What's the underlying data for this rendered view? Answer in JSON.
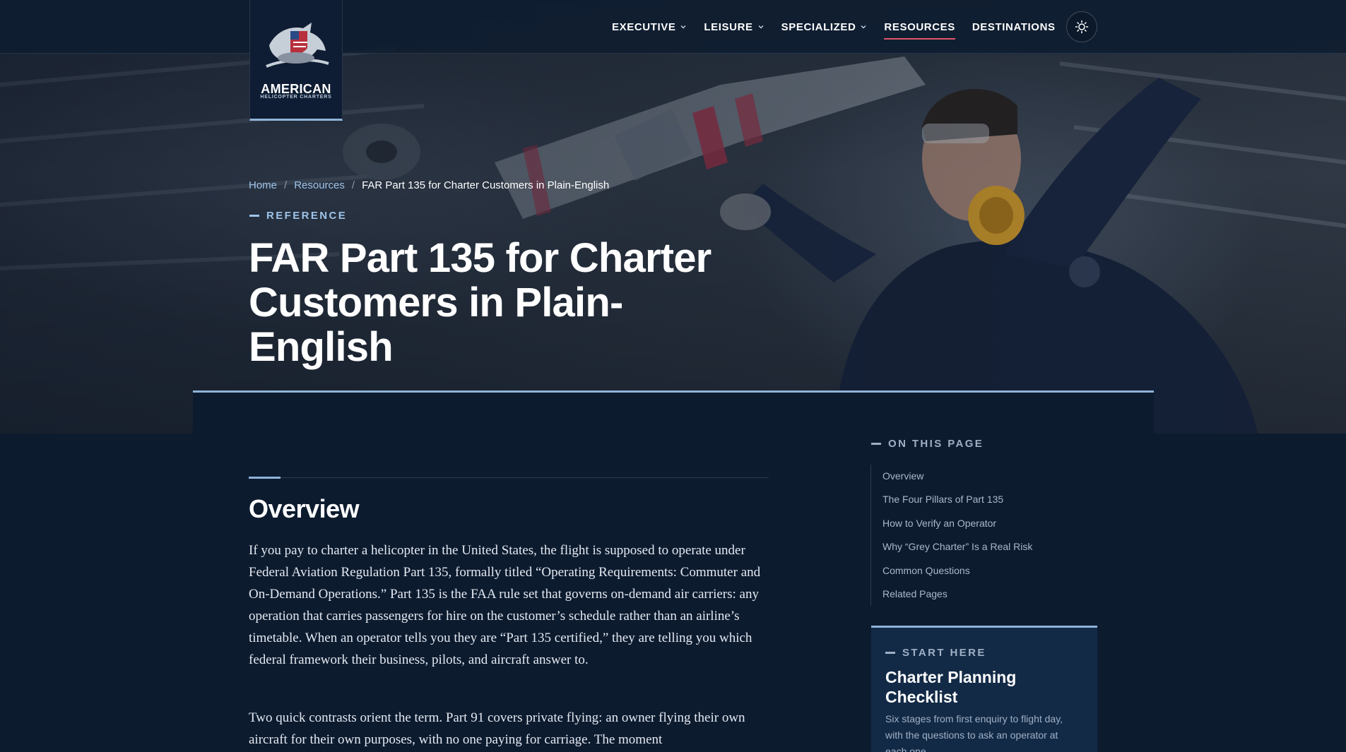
{
  "brand": {
    "name": "AMERICAN",
    "tagline": "HELICOPTER CHARTERS"
  },
  "nav": {
    "items": [
      {
        "label": "EXECUTIVE",
        "has_dropdown": true
      },
      {
        "label": "LEISURE",
        "has_dropdown": true
      },
      {
        "label": "SPECIALIZED",
        "has_dropdown": true
      },
      {
        "label": "RESOURCES",
        "has_dropdown": false,
        "active": true
      },
      {
        "label": "DESTINATIONS",
        "has_dropdown": false
      }
    ],
    "theme_toggle_icon": "sun-icon"
  },
  "breadcrumb": {
    "home": "Home",
    "resources": "Resources",
    "current": "FAR Part 135 for Charter Customers in Plain-English"
  },
  "hero": {
    "eyebrow": "REFERENCE",
    "title": "FAR Part 135 for Charter Customers in Plain-English"
  },
  "article": {
    "section_title": "Overview",
    "paragraph1": "If you pay to charter a helicopter in the United States, the flight is supposed to operate under Federal Aviation Regulation Part 135, formally titled “Operating Requirements: Commuter and On-Demand Operations.” Part 135 is the FAA rule set that governs on-demand air carriers: any operation that carries passengers for hire on the customer’s schedule rather than an airline’s timetable. When an operator tells you they are “Part 135 certified,” they are telling you which federal framework their business, pilots, and aircraft answer to.",
    "paragraph2": "Two quick contrasts orient the term. Part 91 covers private flying: an owner flying their own aircraft for their own purposes, with no one paying for carriage. The moment"
  },
  "toc": {
    "heading": "ON THIS PAGE",
    "items": [
      "Overview",
      "The Four Pillars of Part 135",
      "How to Verify an Operator",
      "Why “Grey Charter” Is a Real Risk",
      "Common Questions",
      "Related Pages"
    ]
  },
  "start_here": {
    "eyebrow": "START HERE",
    "title": "Charter Planning Checklist",
    "description": "Six stages from first enquiry to flight day, with the questions to ask an operator at each one."
  },
  "colors": {
    "page_bg": "#0d1b2e",
    "accent_light_blue": "#8fb3d8",
    "nav_active_underline": "#e0566a",
    "link_blue": "#9ec3e8"
  }
}
